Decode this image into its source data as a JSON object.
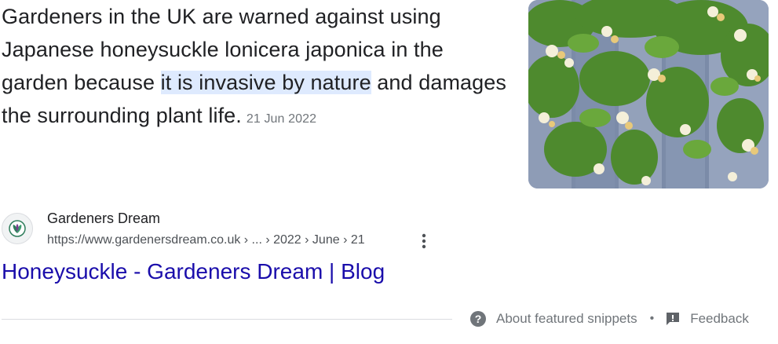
{
  "snippet": {
    "text_before": "Gardeners in the UK are warned against using Japanese honeysuckle lonicera japonica in the garden because ",
    "highlight": "it is invasive by nature",
    "text_after": " and damages the surrounding plant life.",
    "date": "21 Jun 2022"
  },
  "thumbnail": {
    "icon": "honeysuckle-photo"
  },
  "source": {
    "favicon": "gardeners-dream-logo",
    "site_name": "Gardeners Dream",
    "url": "https://www.gardenersdream.co.uk › ... › 2022 › June › 21",
    "more_icon": "more-vert-icon"
  },
  "result": {
    "title": "Honeysuckle - Gardeners Dream | Blog"
  },
  "footer": {
    "about_label": "About featured snippets",
    "separator": "•",
    "feedback_label": "Feedback"
  },
  "colors": {
    "link": "#1a0dab",
    "highlight": "#d3e3fd",
    "muted": "#70757a"
  }
}
